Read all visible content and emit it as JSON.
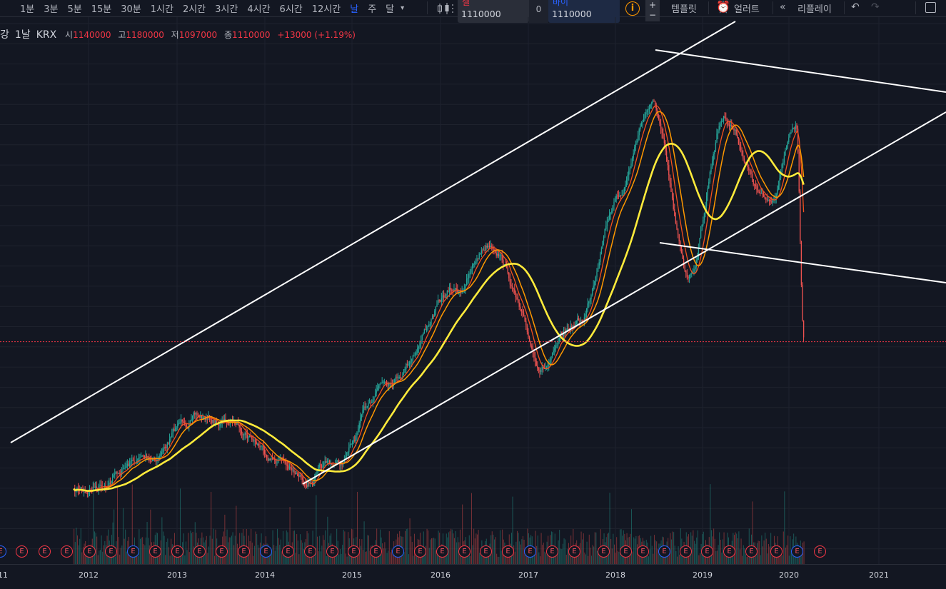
{
  "toolbar": {
    "intervals": [
      "1분",
      "3분",
      "5분",
      "15분",
      "30분",
      "1시간",
      "2시간",
      "3시간",
      "4시간",
      "6시간",
      "12시간",
      "날",
      "주",
      "달"
    ],
    "active_interval": "날",
    "sell_label": "셀",
    "sell_value": "1110000",
    "spread_value": "0",
    "buy_label": "바이",
    "buy_value": "1110000",
    "qty_plus": "+",
    "qty_minus": "−",
    "template_label": "템플릿",
    "alert_label": "얼러트",
    "replay_label": "리플레이"
  },
  "legend": {
    "symbol_partial": "강",
    "interval": "1날",
    "exchange": "KRX",
    "open_label": "시",
    "open_value": "1140000",
    "high_label": "고",
    "high_value": "1180000",
    "low_label": "저",
    "low_value": "1097000",
    "close_label": "종",
    "close_value": "1110000",
    "change_text": "+13000 (+1.19%)"
  },
  "colors": {
    "background": "#131722",
    "up_candle": "#26a69a",
    "down_candle": "#ef5350",
    "ma_fast": "#f4511e",
    "ma_mid": "#ff9800",
    "ma_slow": "#ffeb3b",
    "trendline": "#ffffff",
    "price_line": "#f23645"
  },
  "chart_data": {
    "type": "candlestick",
    "x_axis_labels": [
      "11",
      "2012",
      "2013",
      "2014",
      "2015",
      "2016",
      "2017",
      "2018",
      "2019",
      "2020",
      "2021"
    ],
    "x_range": [
      "2011-11",
      "2021-11"
    ],
    "price_trend": [
      {
        "date": "2011-11",
        "price": 600000
      },
      {
        "date": "2012-09",
        "price": 710000
      },
      {
        "date": "2013-03",
        "price": 850000
      },
      {
        "date": "2013-09",
        "price": 830000
      },
      {
        "date": "2014-03",
        "price": 720000
      },
      {
        "date": "2014-06",
        "price": 640000
      },
      {
        "date": "2014-11",
        "price": 690000
      },
      {
        "date": "2015-06",
        "price": 1000000
      },
      {
        "date": "2016-03",
        "price": 1280000
      },
      {
        "date": "2016-08",
        "price": 1450000
      },
      {
        "date": "2017-03",
        "price": 1030000
      },
      {
        "date": "2017-08",
        "price": 1170000
      },
      {
        "date": "2018-01",
        "price": 1600000
      },
      {
        "date": "2018-06",
        "price": 1920000
      },
      {
        "date": "2018-11",
        "price": 1330000
      },
      {
        "date": "2019-04",
        "price": 1880000
      },
      {
        "date": "2019-10",
        "price": 1580000
      },
      {
        "date": "2020-02",
        "price": 1830000
      },
      {
        "date": "2020-03",
        "price": 1110000
      }
    ],
    "last_price": 1110000,
    "moving_averages": [
      "fast",
      "mid",
      "slow"
    ],
    "earnings_badge_label": "E",
    "grid": true,
    "trendlines": 4
  }
}
